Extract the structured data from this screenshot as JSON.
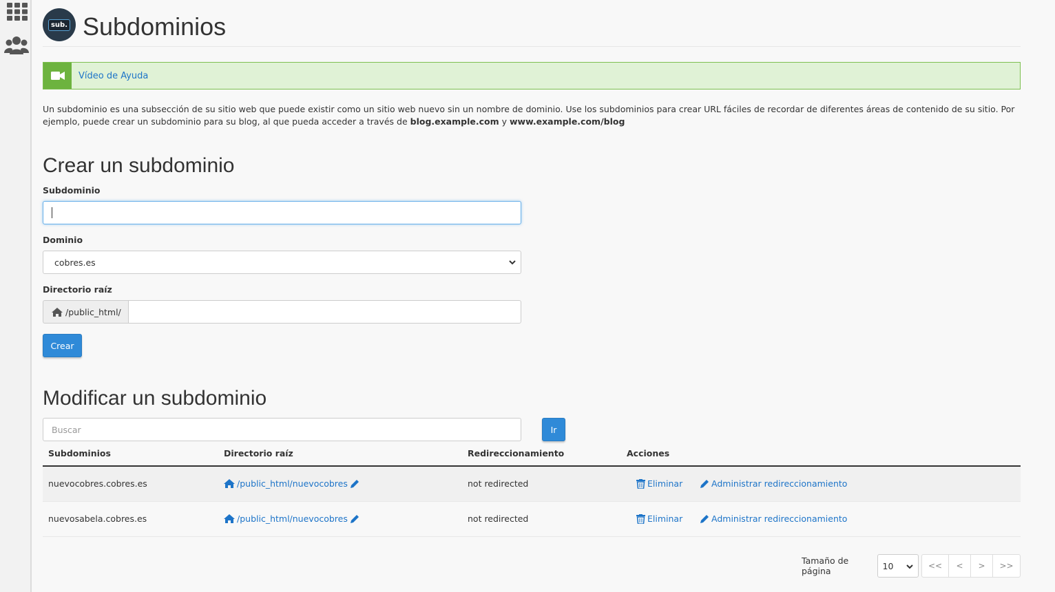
{
  "sidebar": {
    "items": [
      {
        "icon": "grid-icon"
      },
      {
        "icon": "users-icon"
      }
    ]
  },
  "header": {
    "logo_text": "sub.",
    "title": "Subdominios"
  },
  "help": {
    "icon": "video-camera-icon",
    "link_text": "Vídeo de Ayuda"
  },
  "description": {
    "text": "Un subdominio es una subsección de su sitio web que puede existir como un sitio web nuevo sin un nombre de dominio. Use los subdominios para crear URL fáciles de recordar de diferentes áreas de contenido de su sitio. Por ejemplo, puede crear un subdominio para su blog, al que pueda acceder a través de",
    "example1": "blog.example.com",
    "joiner": "y",
    "example2": "www.example.com/blog"
  },
  "create": {
    "title": "Crear un subdominio",
    "subdomain_label": "Subdominio",
    "subdomain_value": "",
    "domain_label": "Dominio",
    "domain_selected": "cobres.es",
    "docroot_label": "Directorio raíz",
    "docroot_prefix": "/public_html/",
    "docroot_value": "",
    "submit_label": "Crear"
  },
  "modify": {
    "title": "Modificar un subdominio",
    "search_placeholder": "Buscar",
    "search_button": "Ir",
    "columns": [
      "Subdominios",
      "Directorio raíz",
      "Redireccionamiento",
      "Acciones"
    ],
    "rows": [
      {
        "subdomain": "nuevocobres.cobres.es",
        "docroot": "/public_html/nuevocobres",
        "redirect": "not redirected",
        "delete_label": "Eliminar",
        "manage_label": "Administrar redireccionamiento"
      },
      {
        "subdomain": "nuevosabela.cobres.es",
        "docroot": "/public_html/nuevocobres",
        "redirect": "not redirected",
        "delete_label": "Eliminar",
        "manage_label": "Administrar redireccionamiento"
      }
    ]
  },
  "pagination": {
    "page_size_label": "Tamaño de página",
    "page_size": "10",
    "first": "<<",
    "prev": "<",
    "next": ">",
    "last": ">>"
  },
  "colors": {
    "accent": "#2f8ad8",
    "link": "#1d74c8",
    "help_bg": "#e0f2d6",
    "help_border": "#7cbf4f",
    "help_icon_bg": "#6db33f"
  }
}
